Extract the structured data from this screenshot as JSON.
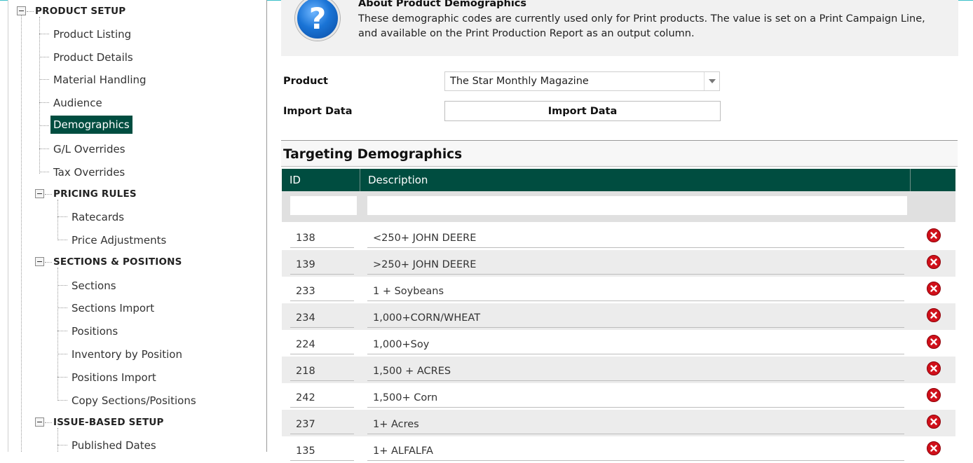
{
  "sidebar": {
    "sections": [
      {
        "label": "PRODUCT SETUP"
      },
      {
        "label": "PRICING RULES"
      },
      {
        "label": "SECTIONS & POSITIONS"
      },
      {
        "label": "ISSUE-BASED SETUP"
      }
    ],
    "product_setup_items": [
      "Product Listing",
      "Product Details",
      "Material Handling",
      "Audience",
      "Demographics",
      "G/L Overrides",
      "Tax Overrides"
    ],
    "pricing_items": [
      "Ratecards",
      "Price Adjustments"
    ],
    "sections_items": [
      "Sections",
      "Sections Import",
      "Positions",
      "Inventory by Position",
      "Positions Import",
      "Copy Sections/Positions"
    ],
    "issue_items": [
      "Published Dates"
    ],
    "selected": "Demographics"
  },
  "about": {
    "title": "About Product Demographics",
    "text": "These demographic codes are currently used only for Print products. The value is set on a Print Campaign Line, and available on the Print Production Report as an output column.",
    "icon": "question-help-icon"
  },
  "form": {
    "product_label": "Product",
    "product_value": "The Star Monthly Magazine",
    "import_label": "Import Data",
    "import_button": "Import Data"
  },
  "targeting": {
    "title": "Targeting Demographics",
    "columns": {
      "id": "ID",
      "description": "Description"
    },
    "rows": [
      {
        "id": "138",
        "description": "<250+ JOHN DEERE"
      },
      {
        "id": "139",
        "description": ">250+ JOHN DEERE"
      },
      {
        "id": "233",
        "description": "1 + Soybeans"
      },
      {
        "id": "234",
        "description": "1,000+CORN/WHEAT"
      },
      {
        "id": "224",
        "description": "1,000+Soy"
      },
      {
        "id": "218",
        "description": "1,500 + ACRES"
      },
      {
        "id": "242",
        "description": "1,500+ Corn"
      },
      {
        "id": "237",
        "description": "1+ Acres"
      },
      {
        "id": "135",
        "description": "1+ ALFALFA"
      }
    ]
  },
  "colors": {
    "accent": "#004d40",
    "delete": "#d0101a"
  }
}
